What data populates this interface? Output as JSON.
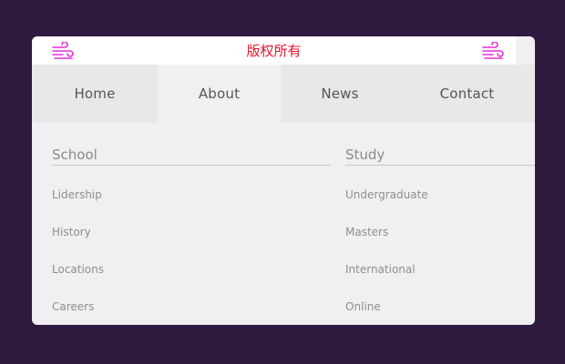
{
  "banner": {
    "text": "版权所有",
    "icon_color": "#e22fd6",
    "text_color": "#e8122f"
  },
  "nav": {
    "items": [
      {
        "label": "Home",
        "active": false
      },
      {
        "label": "About",
        "active": true
      },
      {
        "label": "News",
        "active": false
      },
      {
        "label": "Contact",
        "active": false
      }
    ]
  },
  "menu": {
    "columns": [
      {
        "title": "School",
        "links": [
          "Lidership",
          "History",
          "Locations",
          "Careers"
        ]
      },
      {
        "title": "Study",
        "links": [
          "Undergraduate",
          "Masters",
          "International",
          "Online"
        ]
      }
    ]
  }
}
